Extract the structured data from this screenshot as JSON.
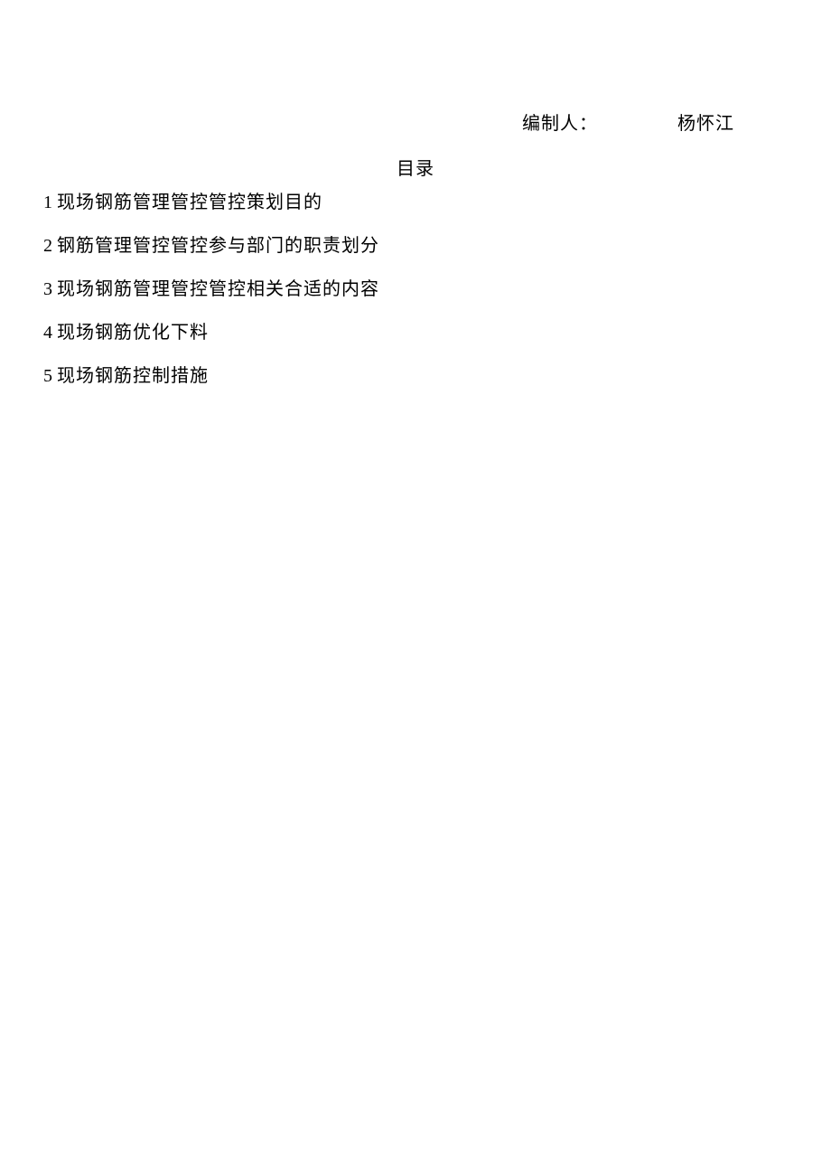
{
  "author": {
    "label": "编制人：",
    "name": "杨怀江"
  },
  "toc": {
    "title": "目录",
    "items": [
      {
        "number": "1",
        "text": "现场钢筋管理管控管控策划目的"
      },
      {
        "number": "2",
        "text": "钢筋管理管控管控参与部门的职责划分"
      },
      {
        "number": "3",
        "text": "现场钢筋管理管控管控相关合适的内容"
      },
      {
        "number": "4",
        "text": "现场钢筋优化下料"
      },
      {
        "number": "5",
        "text": "现场钢筋控制措施"
      }
    ]
  }
}
